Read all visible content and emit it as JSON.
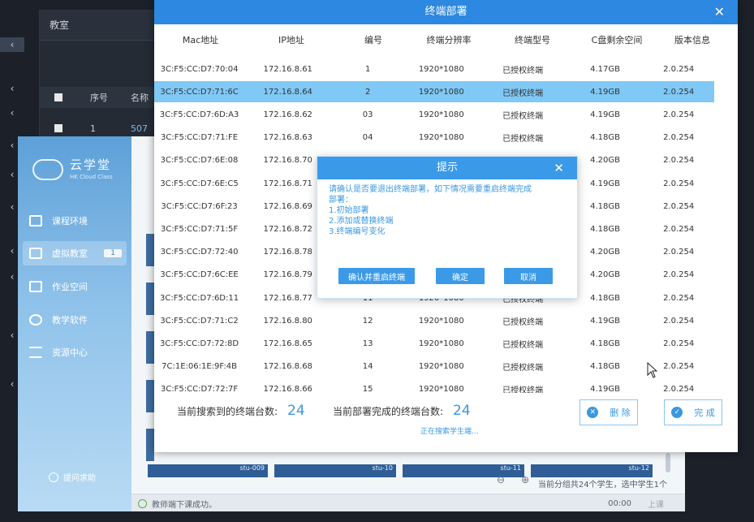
{
  "background": {
    "panel_title": "教室",
    "table_headers": [
      "序号",
      "名称"
    ],
    "row": {
      "index": "1",
      "name": "507"
    }
  },
  "student_app": {
    "brand_name": "云学堂",
    "brand_sub": "HK Cloud Class",
    "nav": [
      {
        "label": "课程环境",
        "icon": "grid-icon"
      },
      {
        "label": "虚拟教室",
        "icon": "monitor-icon",
        "badge": "1"
      },
      {
        "label": "作业空间",
        "icon": "calendar-icon"
      },
      {
        "label": "教学软件",
        "icon": "user-icon"
      },
      {
        "label": "资源中心",
        "icon": "layers-icon"
      }
    ],
    "help_label": "提问求助",
    "status_message": "教师端下课成功。",
    "status_time": "00:00",
    "status_action": "上课",
    "group_info": "当前分组共24个学生，选中学生1个",
    "thumb_labels": [
      "stu-009",
      "stu-10",
      "stu-11",
      "stu-12"
    ]
  },
  "deploy_dialog": {
    "title": "终端部署",
    "columns": [
      "Mac地址",
      "IP地址",
      "编号",
      "终端分辨率",
      "终端型号",
      "C盘剩余空间",
      "版本信息"
    ],
    "rows": [
      {
        "mac": "3C:F5:CC:D7:70:04",
        "ip": "172.16.8.61",
        "no": "1",
        "res": "1920*1080",
        "model": "已授权终端",
        "disk": "4.17GB",
        "ver": "2.0.254"
      },
      {
        "mac": "3C:F5:CC:D7:71:6C",
        "ip": "172.16.8.64",
        "no": "2",
        "res": "1920*1080",
        "model": "已授权终端",
        "disk": "4.19GB",
        "ver": "2.0.254"
      },
      {
        "mac": "3C:F5:CC:D7:6D:A3",
        "ip": "172.16.8.62",
        "no": "03",
        "res": "1920*1080",
        "model": "已授权终端",
        "disk": "4.19GB",
        "ver": "2.0.254"
      },
      {
        "mac": "3C:F5:CC:D7:71:FE",
        "ip": "172.16.8.63",
        "no": "04",
        "res": "1920*1080",
        "model": "已授权终端",
        "disk": "4.18GB",
        "ver": "2.0.254"
      },
      {
        "mac": "3C:F5:CC:D7:6E:08",
        "ip": "172.16.8.70",
        "no": "",
        "res": "",
        "model": "",
        "disk": "4.20GB",
        "ver": "2.0.254"
      },
      {
        "mac": "3C:F5:CC:D7:6E:C5",
        "ip": "172.16.8.71",
        "no": "",
        "res": "",
        "model": "",
        "disk": "4.19GB",
        "ver": "2.0.254"
      },
      {
        "mac": "3C:F5:CC:D7:6F:23",
        "ip": "172.16.8.69",
        "no": "",
        "res": "",
        "model": "",
        "disk": "4.18GB",
        "ver": "2.0.254"
      },
      {
        "mac": "3C:F5:CC:D7:71:5F",
        "ip": "172.16.8.72",
        "no": "",
        "res": "",
        "model": "",
        "disk": "4.18GB",
        "ver": "2.0.254"
      },
      {
        "mac": "3C:F5:CC:D7:72:40",
        "ip": "172.16.8.78",
        "no": "",
        "res": "",
        "model": "",
        "disk": "4.20GB",
        "ver": "2.0.254"
      },
      {
        "mac": "3C:F5:CC:D7:6C:EE",
        "ip": "172.16.8.79",
        "no": "",
        "res": "",
        "model": "",
        "disk": "4.20GB",
        "ver": "2.0.254"
      },
      {
        "mac": "3C:F5:CC:D7:6D:11",
        "ip": "172.16.8.77",
        "no": "11",
        "res": "1920*1080",
        "model": "已授权终端",
        "disk": "4.18GB",
        "ver": "2.0.254"
      },
      {
        "mac": "3C:F5:CC:D7:71:C2",
        "ip": "172.16.8.80",
        "no": "12",
        "res": "1920*1080",
        "model": "已授权终端",
        "disk": "4.19GB",
        "ver": "2.0.254"
      },
      {
        "mac": "3C:F5:CC:D7:72:8D",
        "ip": "172.16.8.65",
        "no": "13",
        "res": "1920*1080",
        "model": "已授权终端",
        "disk": "4.18GB",
        "ver": "2.0.254"
      },
      {
        "mac": "7C:1E:06:1E:9F:4B",
        "ip": "172.16.8.68",
        "no": "14",
        "res": "1920*1080",
        "model": "已授权终端",
        "disk": "4.18GB",
        "ver": "2.0.254"
      },
      {
        "mac": "3C:F5:CC:D7:72:7F",
        "ip": "172.16.8.66",
        "no": "15",
        "res": "1920*1080",
        "model": "已授权终端",
        "disk": "4.19GB",
        "ver": "2.0.254"
      }
    ],
    "selected_row": 1,
    "searched_label": "当前搜索到的终端台数:",
    "searched_count": "24",
    "deployed_label": "当前部署完成的终端台数:",
    "deployed_count": "24",
    "searching_text": "正在搜索学生端...",
    "delete_label": "删 除",
    "done_label": "完 成"
  },
  "confirm_popup": {
    "title": "提示",
    "message_lines": [
      "请确认是否要退出终端部署，如下情况需要重启终端完成",
      "部署：",
      "1.初始部署",
      "2.添加或替换终端",
      "3.终端编号变化"
    ],
    "restart_label": "确认并重启终端",
    "ok_label": "确定",
    "cancel_label": "取消"
  },
  "colors": {
    "accent": "#2c88e0",
    "selected_row": "#80c8f5",
    "count_blue": "#3a98e0"
  }
}
